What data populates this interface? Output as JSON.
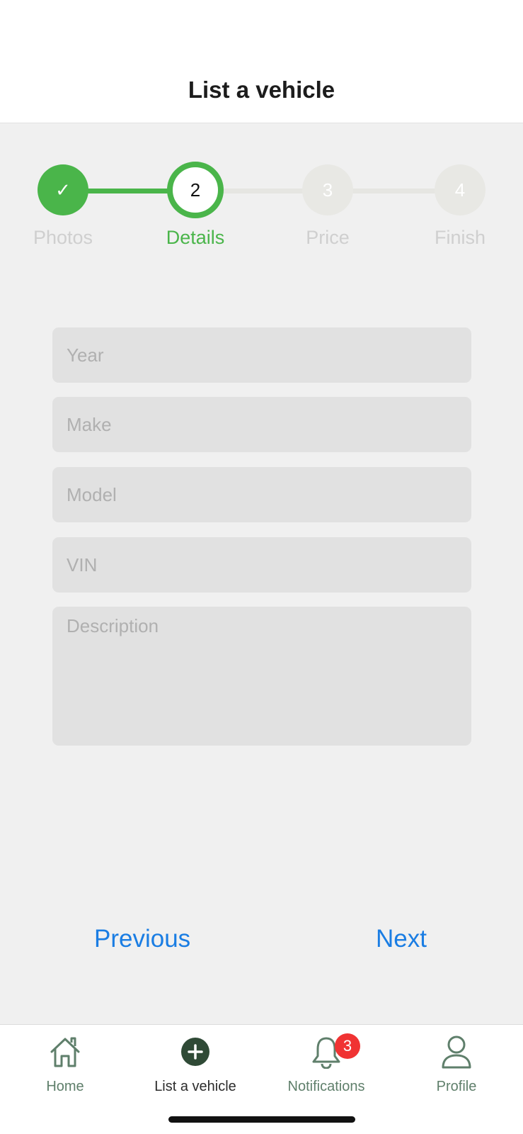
{
  "header": {
    "title": "List a vehicle"
  },
  "stepper": {
    "steps": [
      {
        "number": "1",
        "label": "Photos",
        "state": "done",
        "symbol": "✓"
      },
      {
        "number": "2",
        "label": "Details",
        "state": "current",
        "symbol": "2"
      },
      {
        "number": "3",
        "label": "Price",
        "state": "todo",
        "symbol": "3"
      },
      {
        "number": "4",
        "label": "Finish",
        "state": "todo",
        "symbol": "4"
      }
    ]
  },
  "form": {
    "year_placeholder": "Year",
    "make_placeholder": "Make",
    "model_placeholder": "Model",
    "vin_placeholder": "VIN",
    "description_placeholder": "Description"
  },
  "navigation": {
    "previous_label": "Previous",
    "next_label": "Next"
  },
  "tabbar": {
    "items": [
      {
        "label": "Home",
        "icon": "home-icon"
      },
      {
        "label": "List a vehicle",
        "icon": "plus-circle-icon",
        "active": true
      },
      {
        "label": "Notifications",
        "icon": "bell-icon",
        "badge": "3"
      },
      {
        "label": "Profile",
        "icon": "person-icon"
      }
    ]
  },
  "colors": {
    "accent_green": "#4ab54a",
    "link_blue": "#1a7de3",
    "badge_red": "#f03333",
    "tab_icon_green": "#5f7f6b",
    "active_tab_dark": "#2f4a36"
  }
}
